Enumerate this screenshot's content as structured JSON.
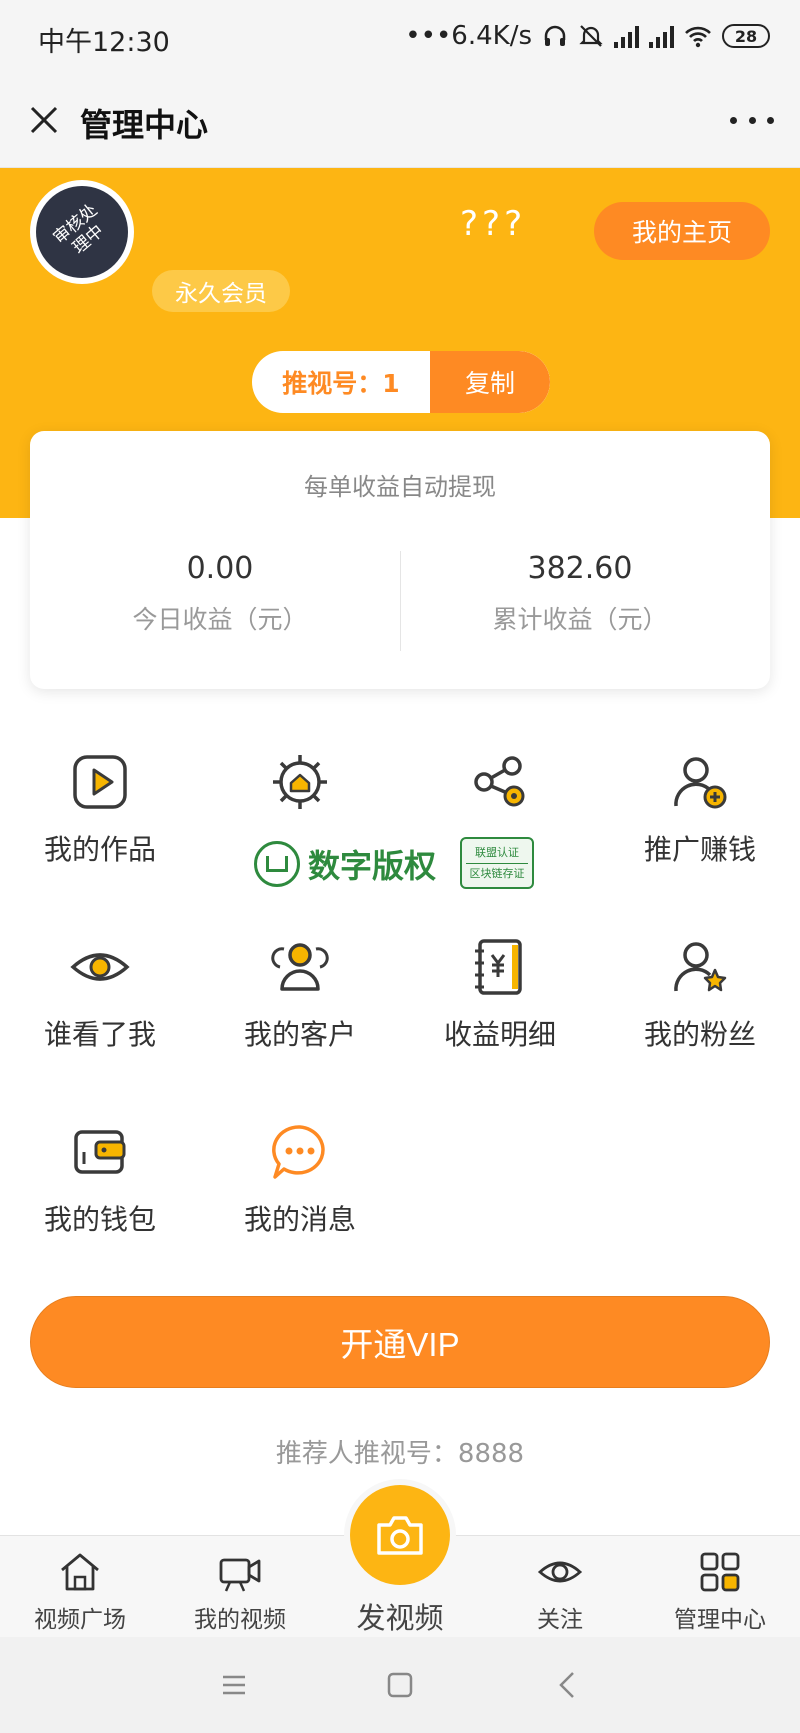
{
  "status_bar": {
    "time": "中午12:30",
    "network_speed": "•••6.4K/s",
    "battery_level": "28"
  },
  "title_bar": {
    "title": "管理中心"
  },
  "profile": {
    "avatar_text": "审核处理中",
    "nickname": "???",
    "home_button": "我的主页",
    "member_badge": "永久会员",
    "referral_label": "推视号：1",
    "copy_button": "复制"
  },
  "earnings": {
    "note": "每单收益自动提现",
    "today_value": "0.00",
    "today_label": "今日收益（元）",
    "total_value": "382.60",
    "total_label": "累计收益（元）"
  },
  "menu": {
    "items": [
      {
        "label": "我的作品",
        "icon": "play-icon"
      },
      {
        "label": "",
        "icon": "settings-home-icon"
      },
      {
        "label": "",
        "icon": "share-gear-icon"
      },
      {
        "label": "推广赚钱",
        "icon": "user-plus-icon"
      },
      {
        "label": "谁看了我",
        "icon": "eye-icon"
      },
      {
        "label": "我的客户",
        "icon": "users-icon"
      },
      {
        "label": "收益明细",
        "icon": "yuan-book-icon"
      },
      {
        "label": "我的粉丝",
        "icon": "user-star-icon"
      },
      {
        "label": "我的钱包",
        "icon": "wallet-icon"
      },
      {
        "label": "我的消息",
        "icon": "chat-icon"
      }
    ]
  },
  "copyright": {
    "text": "数字版权",
    "stamp_line1": "联盟认证",
    "stamp_line2": "区块链存证"
  },
  "vip_button": "开通VIP",
  "referrer": "推荐人推视号：8888",
  "tabbar": {
    "items": [
      {
        "label": "视频广场",
        "icon": "home-icon"
      },
      {
        "label": "我的视频",
        "icon": "video-camera-icon"
      },
      {
        "label": "发视频",
        "icon": "camera-icon"
      },
      {
        "label": "关注",
        "icon": "eye-icon"
      },
      {
        "label": "管理中心",
        "icon": "grid-icon"
      }
    ]
  },
  "colors": {
    "brand_yellow": "#fdb513",
    "accent_orange": "#fe8a23",
    "icon_dark": "#3a3a3a",
    "icon_accent": "#f7b500"
  }
}
